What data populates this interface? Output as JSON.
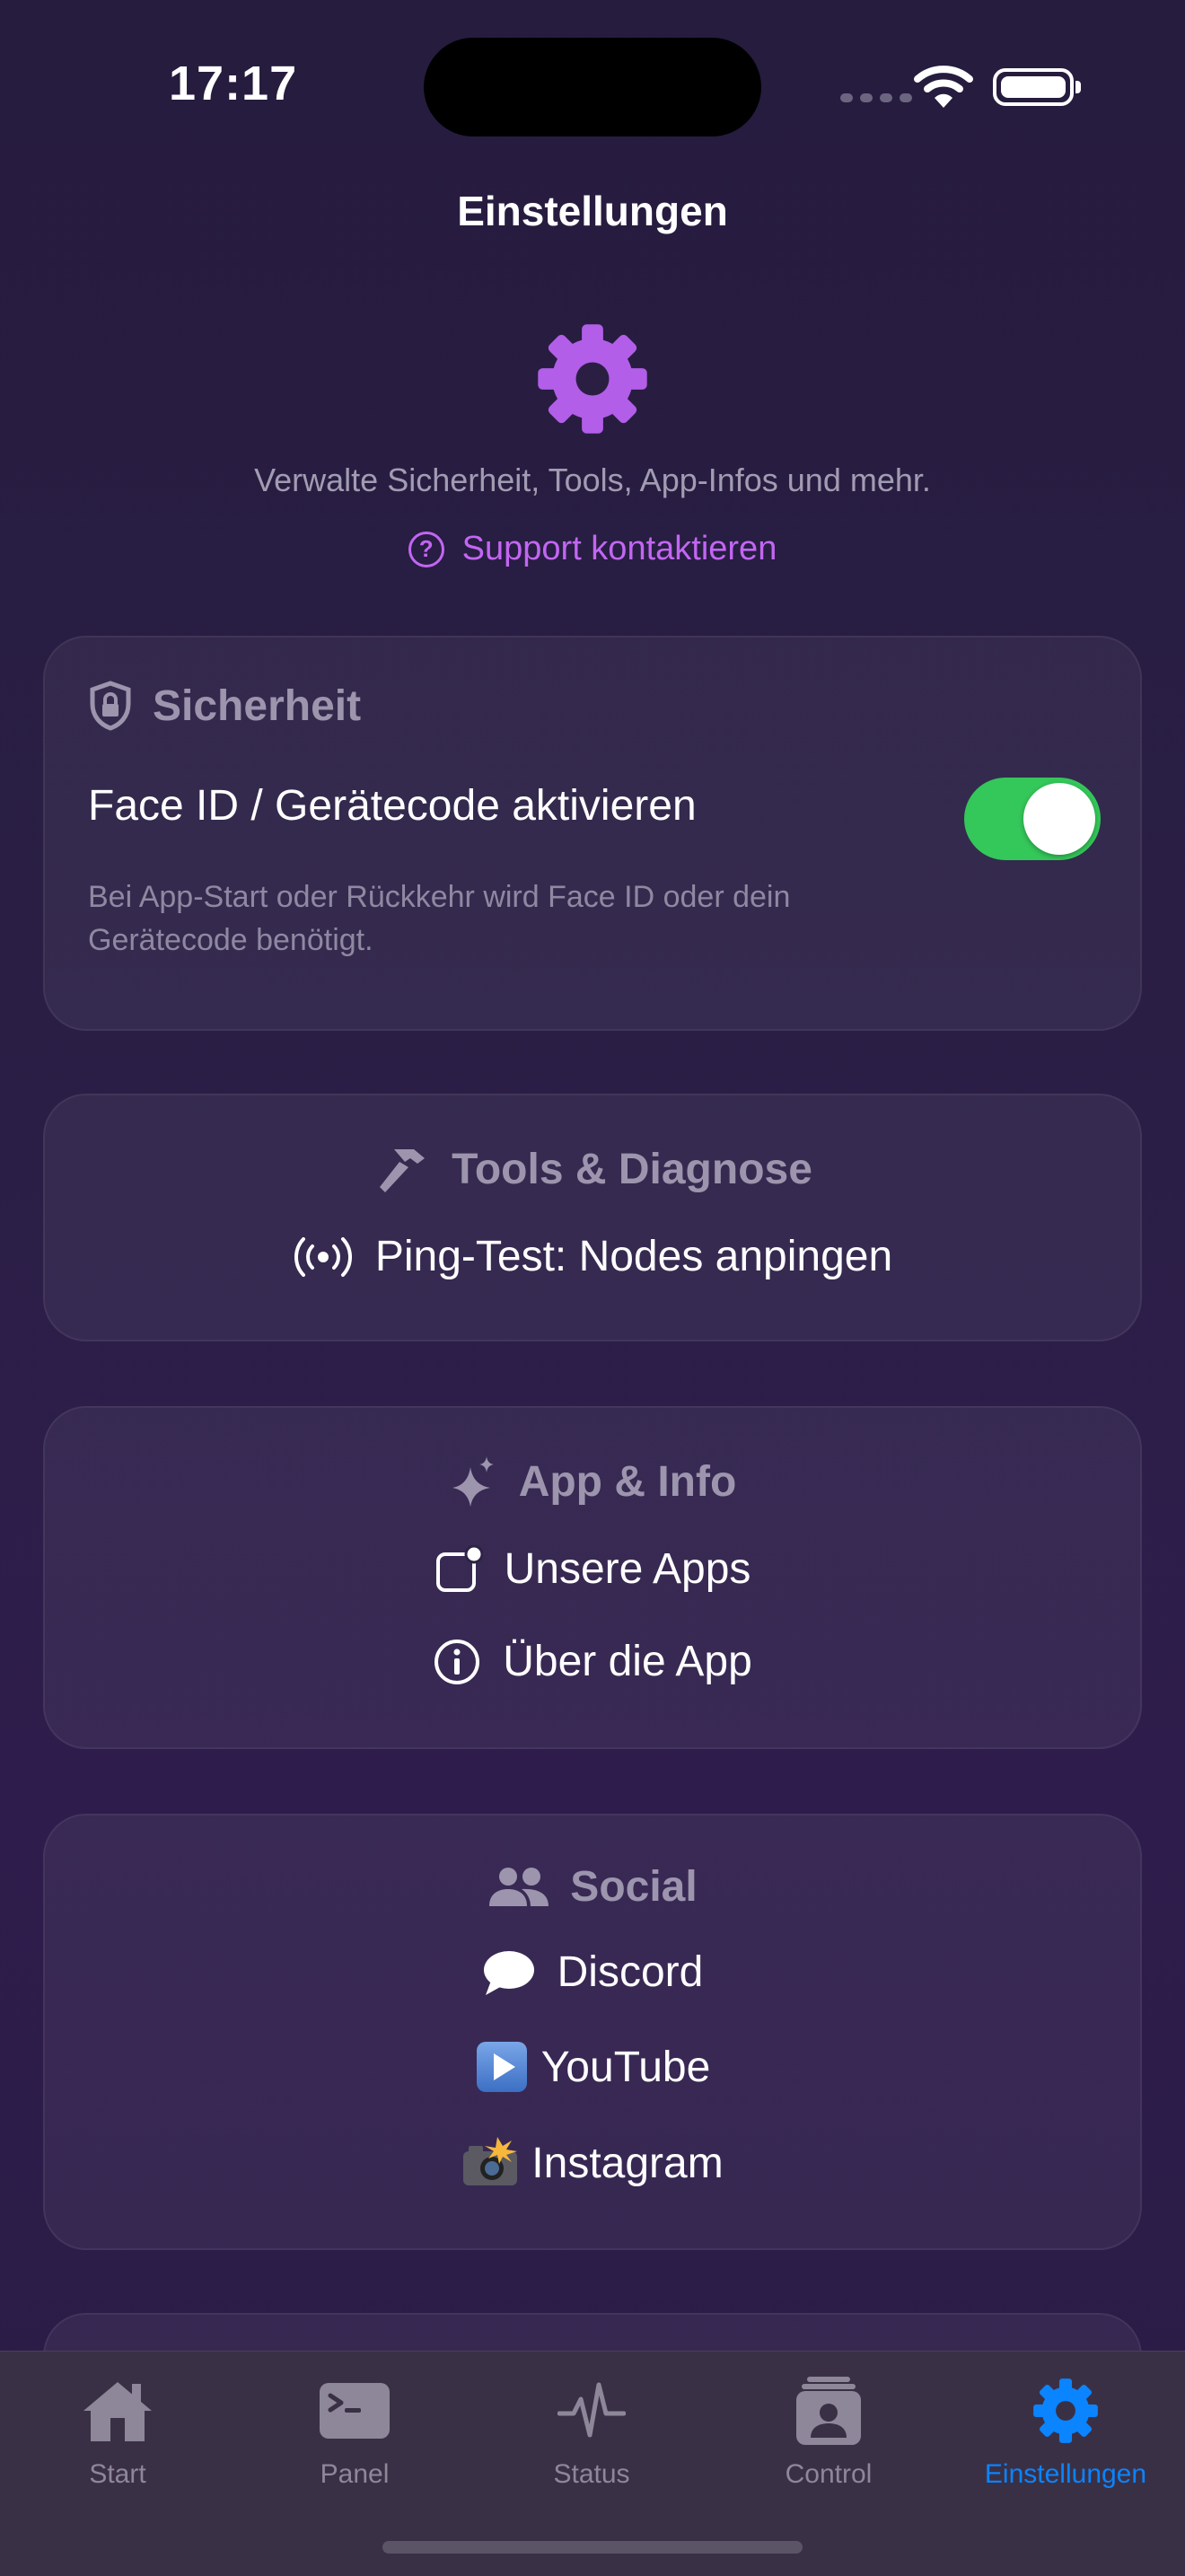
{
  "status_bar": {
    "time": "17:17"
  },
  "nav": {
    "title": "Einstellungen"
  },
  "header": {
    "icon": "gear-icon",
    "subtitle": "Verwalte Sicherheit, Tools, App-Infos und mehr.",
    "support_link": "Support kontaktieren"
  },
  "security": {
    "title": "Sicherheit",
    "toggle_label": "Face ID / Gerätecode aktivieren",
    "toggle_on": true,
    "hint_line1": "Bei App-Start oder Rückkehr wird Face ID oder dein",
    "hint_line2": "Gerätecode benötigt."
  },
  "tools": {
    "title": "Tools & Diagnose",
    "items": [
      {
        "label": "Ping-Test: Nodes anpingen",
        "icon": "antenna-icon"
      }
    ]
  },
  "app_info": {
    "title": "App & Info",
    "items": [
      {
        "label": "Unsere Apps",
        "icon": "app-badge-icon"
      },
      {
        "label": "Über die App",
        "icon": "info-icon"
      }
    ]
  },
  "social": {
    "title": "Social",
    "items": [
      {
        "label": "Discord",
        "icon": "speech-bubble-icon"
      },
      {
        "label": "YouTube",
        "icon": "play-button-icon"
      },
      {
        "label": "Instagram",
        "icon": "camera-flash-icon"
      }
    ]
  },
  "tabbar": {
    "tabs": [
      {
        "label": "Start",
        "icon": "house-icon",
        "active": false
      },
      {
        "label": "Panel",
        "icon": "terminal-icon",
        "active": false
      },
      {
        "label": "Status",
        "icon": "waveform-icon",
        "active": false
      },
      {
        "label": "Control",
        "icon": "id-card-icon",
        "active": false
      },
      {
        "label": "Einstellungen",
        "icon": "gear-icon",
        "active": true
      }
    ],
    "active_color": "#0a84ff"
  },
  "colors": {
    "accent": "#c266f2",
    "toggle_on": "#34c759"
  }
}
